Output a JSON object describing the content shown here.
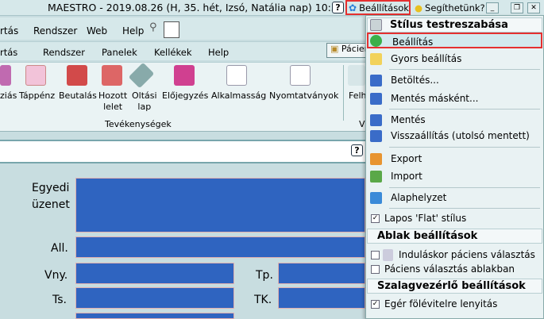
{
  "titlebar": {
    "title": "MAESTRO - 2019.08.26 (H, 35. hét, Izsó, Natália nap) 10:33",
    "help_q": "?",
    "settings_label": "Beállítások",
    "help_label": "Segíthetünk?"
  },
  "menubar1": [
    "rtás",
    "Rendszer",
    "Web",
    "Help"
  ],
  "menubar2": [
    "rtás",
    "Rendszer",
    "Panelek",
    "Kellékek",
    "Help"
  ],
  "patient_button": "Pácien",
  "ribbon": {
    "items": [
      "ziás",
      "Táppénz",
      "Beutalás",
      "Hozott\nlelet",
      "Oltási\nlap",
      "Előjegyzés",
      "Alkalmasság",
      "Nyomtatványok",
      "Felh"
    ],
    "group_label": "Tevékenységek",
    "right_group_label": "V"
  },
  "form": {
    "labels": [
      "Egyedi",
      "üzenet",
      "All.",
      "Vny.",
      "Ts.",
      "Tp.",
      "TK."
    ]
  },
  "dropdown": {
    "header1": "Stílus testreszabása",
    "items": [
      "Beállítás",
      "Gyors beállítás",
      "Betöltés...",
      "Mentés másként...",
      "Mentés",
      "Visszaállítás (utolsó mentett)",
      "Export",
      "Import",
      "Alaphelyzet"
    ],
    "flat_style": "Lapos 'Flat' stílus",
    "header2": "Ablak beállítások",
    "window_items": [
      "Induláskor páciens választás",
      "Páciens választás ablakban"
    ],
    "header3": "Szalagvezérlő beállítások",
    "ribbon_items": [
      "Egér fölévitelre lenyitás"
    ]
  }
}
